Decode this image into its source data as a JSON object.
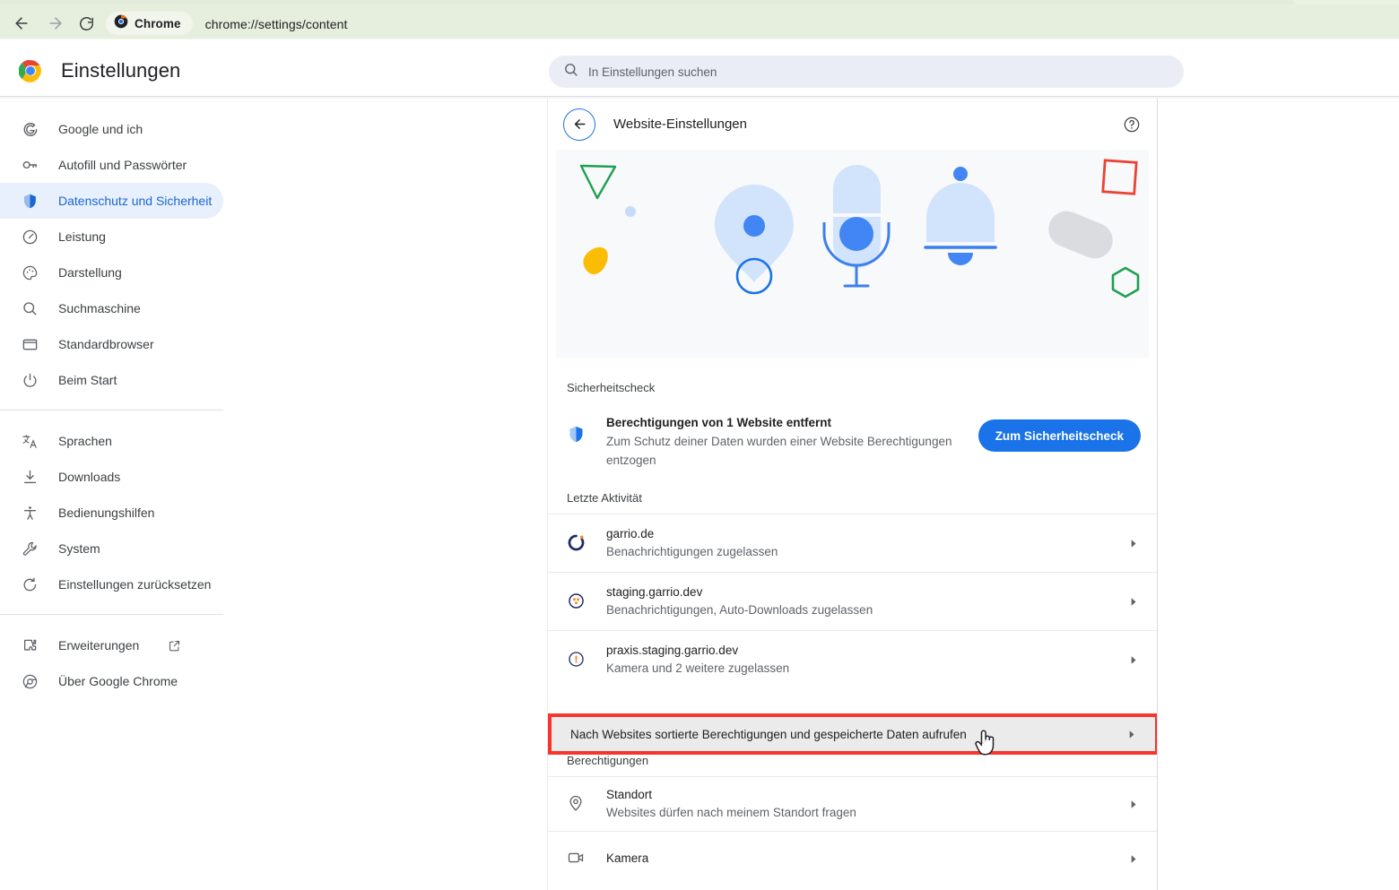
{
  "browser": {
    "back_icon": "arrow-left-icon",
    "forward_icon": "arrow-right-icon",
    "reload_icon": "reload-icon",
    "profile_pill_label": "Chrome",
    "profile_pill_icon": "chrome-icon",
    "url": "chrome://settings/content",
    "toolbar_bg": "#e6eedd"
  },
  "header": {
    "logo_icon": "chrome-logo-icon",
    "title": "Einstellungen",
    "search": {
      "icon": "search-icon",
      "placeholder": "In Einstellungen suchen",
      "value": ""
    }
  },
  "sidebar": {
    "groups": [
      {
        "items": [
          {
            "icon": "google-g-icon",
            "label": "Google und ich",
            "active": false
          },
          {
            "icon": "key-icon",
            "label": "Autofill und Passwörter",
            "active": false
          },
          {
            "icon": "shield-icon",
            "label": "Datenschutz und Sicherheit",
            "active": true
          },
          {
            "icon": "speedometer-icon",
            "label": "Leistung",
            "active": false
          },
          {
            "icon": "palette-icon",
            "label": "Darstellung",
            "active": false
          },
          {
            "icon": "search-icon",
            "label": "Suchmaschine",
            "active": false
          },
          {
            "icon": "browser-window-icon",
            "label": "Standardbrowser",
            "active": false
          },
          {
            "icon": "power-icon",
            "label": "Beim Start",
            "active": false
          }
        ]
      },
      {
        "items": [
          {
            "icon": "translate-icon",
            "label": "Sprachen",
            "active": false
          },
          {
            "icon": "download-icon",
            "label": "Downloads",
            "active": false
          },
          {
            "icon": "accessibility-icon",
            "label": "Bedienungshilfen",
            "active": false
          },
          {
            "icon": "wrench-icon",
            "label": "System",
            "active": false
          },
          {
            "icon": "restore-icon",
            "label": "Einstellungen zurücksetzen",
            "active": false
          }
        ]
      },
      {
        "items": [
          {
            "icon": "puzzle-icon",
            "label": "Erweiterungen",
            "active": false,
            "external": true,
            "external_icon": "open-in-new-icon"
          },
          {
            "icon": "chrome-circle-icon",
            "label": "Über Google Chrome",
            "active": false
          }
        ]
      }
    ]
  },
  "main": {
    "back_icon": "arrow-left-icon",
    "title": "Website-Einstellungen",
    "help_icon": "help-circle-icon",
    "hero": {
      "name": "site-settings-illustration",
      "background": "#f8f9fb",
      "shapes": [
        "green-triangle",
        "small-blue-dot",
        "yellow-blob",
        "location-pin",
        "microphone",
        "bell",
        "grey-capsule",
        "red-square",
        "green-hexagon"
      ]
    },
    "security_check": {
      "section_label": "Sicherheitscheck",
      "icon": "shield-icon",
      "title": "Berechtigungen von 1 Website entfernt",
      "subtitle": "Zum Schutz deiner Daten wurden einer Website Berechtigungen entzogen",
      "button_label": "Zum Sicherheitscheck",
      "button_color": "#1a73e8"
    },
    "recent_activity": {
      "section_label": "Letzte Aktivität",
      "items": [
        {
          "favicon": "garrio-ring-favicon",
          "site": "garrio.de",
          "detail": "Benachrichtigungen zugelassen",
          "chevron": "chevron-right-icon"
        },
        {
          "favicon": "garrio-dots-favicon",
          "site": "staging.garrio.dev",
          "detail": "Benachrichtigungen, Auto-Downloads zugelassen",
          "chevron": "chevron-right-icon"
        },
        {
          "favicon": "garrio-small-favicon",
          "site": "praxis.staging.garrio.dev",
          "detail": "Kamera und 2 weitere zugelassen",
          "chevron": "chevron-right-icon"
        }
      ]
    },
    "all_sites_row": {
      "label": "Nach Websites sortierte Berechtigungen und gespeicherte Daten aufrufen",
      "chevron": "chevron-right-icon",
      "highlight_color": "#f9342b",
      "highlighted": true
    },
    "permissions": {
      "section_label": "Berechtigungen",
      "items": [
        {
          "icon": "location-pin-icon",
          "title": "Standort",
          "detail": "Websites dürfen nach meinem Standort fragen",
          "chevron": "chevron-right-icon"
        },
        {
          "icon": "camera-icon",
          "title": "Kamera",
          "detail": "",
          "chevron": "chevron-right-icon"
        }
      ]
    }
  },
  "cursor": {
    "type": "pointing-hand-cursor"
  }
}
